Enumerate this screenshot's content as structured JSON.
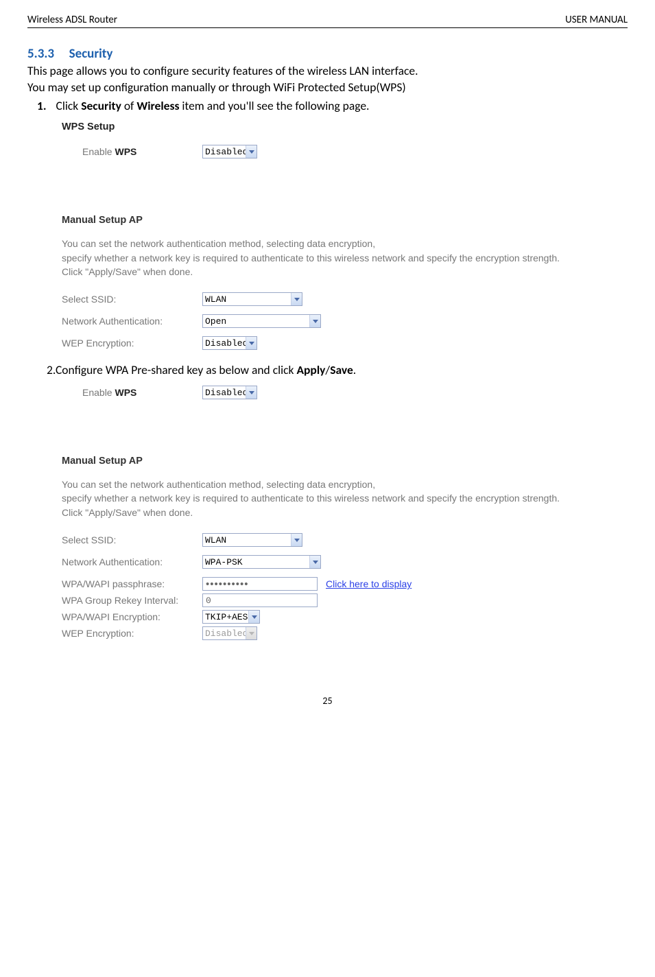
{
  "header": {
    "left": "Wireless ADSL Router",
    "right": "USER MANUAL"
  },
  "section": {
    "num": "5.3.3",
    "title": "Security"
  },
  "intro": {
    "line1": "This page allows you to configure security features of the wireless LAN interface.",
    "line2": "You may set up configuration manually or through WiFi Protected Setup(WPS)"
  },
  "step1": {
    "num": "1.",
    "pre": "Click ",
    "b1": "Security",
    "mid": " of ",
    "b2": "Wireless",
    "post": " item and you'll see the following page."
  },
  "panel1": {
    "wps_heading_pre": "WPS Setup",
    "enable_label_pre": "Enable ",
    "enable_label_bold": "WPS",
    "enable_value": "Disabled",
    "manual_heading": "Manual Setup AP",
    "desc_l1": "You can set the network authentication method, selecting data encryption,",
    "desc_l2": "specify whether a network key is required to authenticate to this wireless network and specify the encryption strength.",
    "desc_l3": "Click \"Apply/Save\" when done.",
    "ssid_label": "Select SSID:",
    "ssid_value": "WLAN",
    "auth_label": "Network Authentication:",
    "auth_value": "Open",
    "wep_label": "WEP Encryption:",
    "wep_value": "Disabled"
  },
  "step2": {
    "pre": "2.Configure WPA Pre-shared key as below and click ",
    "b1": "Apply",
    "slash": "/",
    "b2": "Save",
    "post": "."
  },
  "panel2": {
    "enable_label_pre": "Enable ",
    "enable_label_bold": "WPS",
    "enable_value": "Disabled",
    "manual_heading": "Manual Setup AP",
    "desc_l1": "You can set the network authentication method, selecting data encryption,",
    "desc_l2": "specify whether a network key is required to authenticate to this wireless network and specify the encryption strength.",
    "desc_l3": "Click \"Apply/Save\" when done.",
    "ssid_label": "Select SSID:",
    "ssid_value": "WLAN",
    "auth_label": "Network Authentication:",
    "auth_value": "WPA-PSK",
    "pass_label": "WPA/WAPI passphrase:",
    "pass_value": "••••••••••",
    "link_text": "Click here to display",
    "rekey_label": "WPA Group Rekey Interval:",
    "rekey_value": "0",
    "enc_label": "WPA/WAPI Encryption:",
    "enc_value": "TKIP+AES",
    "wep_label": "WEP Encryption:",
    "wep_value": "Disabled"
  },
  "page_number": "25"
}
